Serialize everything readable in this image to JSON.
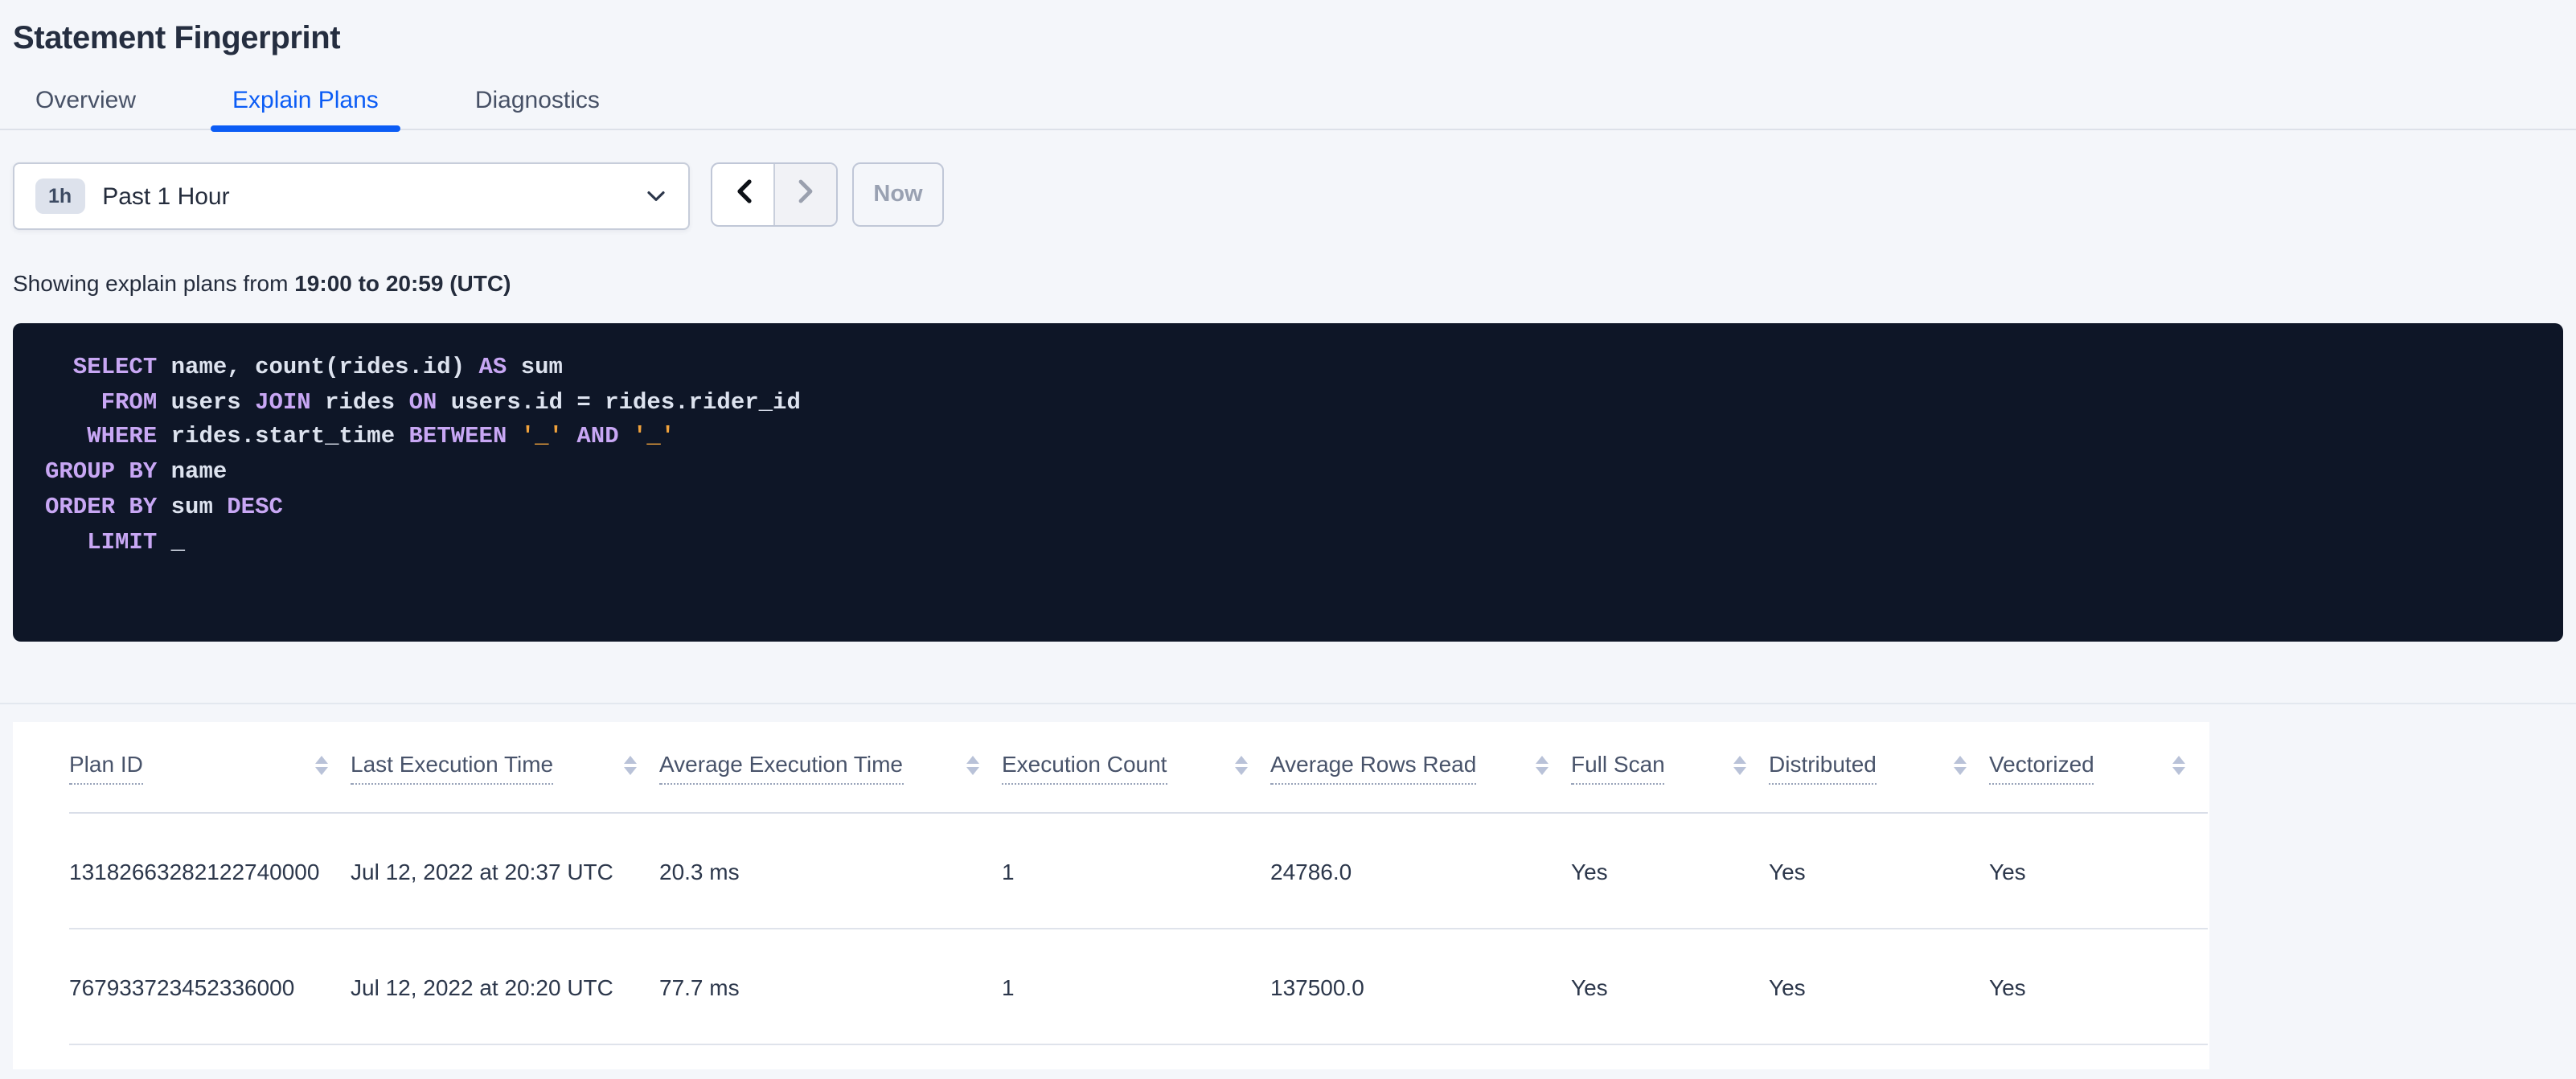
{
  "page": {
    "title": "Statement Fingerprint"
  },
  "tabs": [
    {
      "label": "Overview",
      "active": false
    },
    {
      "label": "Explain Plans",
      "active": true
    },
    {
      "label": "Diagnostics",
      "active": false
    }
  ],
  "time_picker": {
    "badge": "1h",
    "selected": "Past 1 Hour",
    "prev_enabled": true,
    "next_enabled": false,
    "now_label": "Now"
  },
  "subtitle": {
    "prefix": "Showing explain plans from ",
    "range": "19:00 to 20:59 (UTC)"
  },
  "sql": {
    "lines": [
      [
        {
          "t": "kw",
          "s": "  SELECT"
        },
        {
          "t": "id",
          "s": " name, count(rides.id) "
        },
        {
          "t": "kw",
          "s": "AS"
        },
        {
          "t": "id",
          "s": " sum"
        }
      ],
      [
        {
          "t": "kw",
          "s": "    FROM"
        },
        {
          "t": "id",
          "s": " users "
        },
        {
          "t": "kw",
          "s": "JOIN"
        },
        {
          "t": "id",
          "s": " rides "
        },
        {
          "t": "kw",
          "s": "ON"
        },
        {
          "t": "id",
          "s": " users.id = rides.rider_id"
        }
      ],
      [
        {
          "t": "kw",
          "s": "   WHERE"
        },
        {
          "t": "id",
          "s": " rides.start_time "
        },
        {
          "t": "kw",
          "s": "BETWEEN"
        },
        {
          "t": "id",
          "s": " "
        },
        {
          "t": "lit",
          "s": "'_'"
        },
        {
          "t": "id",
          "s": " "
        },
        {
          "t": "kw",
          "s": "AND"
        },
        {
          "t": "id",
          "s": " "
        },
        {
          "t": "lit",
          "s": "'_'"
        }
      ],
      [
        {
          "t": "kw",
          "s": "GROUP BY"
        },
        {
          "t": "id",
          "s": " name"
        }
      ],
      [
        {
          "t": "kw",
          "s": "ORDER BY"
        },
        {
          "t": "id",
          "s": " sum "
        },
        {
          "t": "kw",
          "s": "DESC"
        }
      ],
      [
        {
          "t": "kw",
          "s": "   LIMIT"
        },
        {
          "t": "id",
          "s": " _"
        }
      ]
    ]
  },
  "table": {
    "headers": [
      "Plan ID",
      "Last Execution Time",
      "Average Execution Time",
      "Execution Count",
      "Average Rows Read",
      "Full Scan",
      "Distributed",
      "Vectorized"
    ],
    "rows": [
      [
        "13182663282122740000",
        "Jul 12, 2022 at 20:37 UTC",
        "20.3 ms",
        "1",
        "24786.0",
        "Yes",
        "Yes",
        "Yes"
      ],
      [
        "767933723452336000",
        "Jul 12, 2022 at 20:20 UTC",
        "77.7 ms",
        "1",
        "137500.0",
        "Yes",
        "Yes",
        "Yes"
      ]
    ]
  },
  "colors": {
    "accent_blue": "#0b5cf5",
    "page_background": "#f4f6fa",
    "sql_background": "#0e1627",
    "sql_keyword": "#c8a7f4",
    "sql_literal": "#f0a23c",
    "sql_text": "#dde3ef"
  },
  "icons": {
    "dropdown": "chevron-down-icon",
    "prev": "chevron-left-icon",
    "next": "chevron-right-icon",
    "sort": "sort-arrows-icon"
  }
}
